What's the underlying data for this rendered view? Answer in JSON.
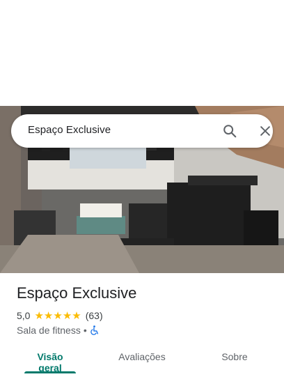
{
  "search": {
    "query": "Espaço Exclusive",
    "search_icon": "search-icon",
    "close_icon": "close-icon"
  },
  "place": {
    "title": "Espaço Exclusive",
    "rating": "5,0",
    "stars": 5,
    "reviews": "(63)",
    "category": "Sala de fitness",
    "separator": "•",
    "accessibility_icon": "wheelchair-icon"
  },
  "tabs": [
    {
      "label": "Visão geral",
      "active": true
    },
    {
      "label": "Avaliações",
      "active": false
    },
    {
      "label": "Sobre",
      "active": false
    }
  ],
  "colors": {
    "accent": "#00796b",
    "star": "#fbbc04",
    "wheelchair": "#1a73e8"
  }
}
